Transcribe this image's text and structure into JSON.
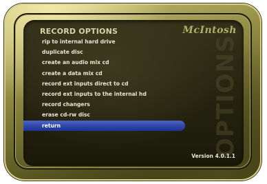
{
  "screen": {
    "title": "RECORD OPTIONS",
    "brand": "McIntosh",
    "watermark": "OPTIONS",
    "version": "Version 4.0.1.1"
  },
  "menu": {
    "items": [
      {
        "label": "rip to internal hard drive"
      },
      {
        "label": "duplicate disc"
      },
      {
        "label": "create an audio mix cd"
      },
      {
        "label": "create a data mix cd"
      },
      {
        "label": "record ext inputs direct to cd"
      },
      {
        "label": "record ext inputs to the internal hd"
      },
      {
        "label": "record changers"
      },
      {
        "label": "erase cd-rw disc"
      },
      {
        "label": "return",
        "selected": true
      }
    ]
  },
  "colors": {
    "selection": "#2e45a8",
    "bezel": "#8d8740",
    "screen": "#25230f",
    "text": "#e8e6d8"
  }
}
